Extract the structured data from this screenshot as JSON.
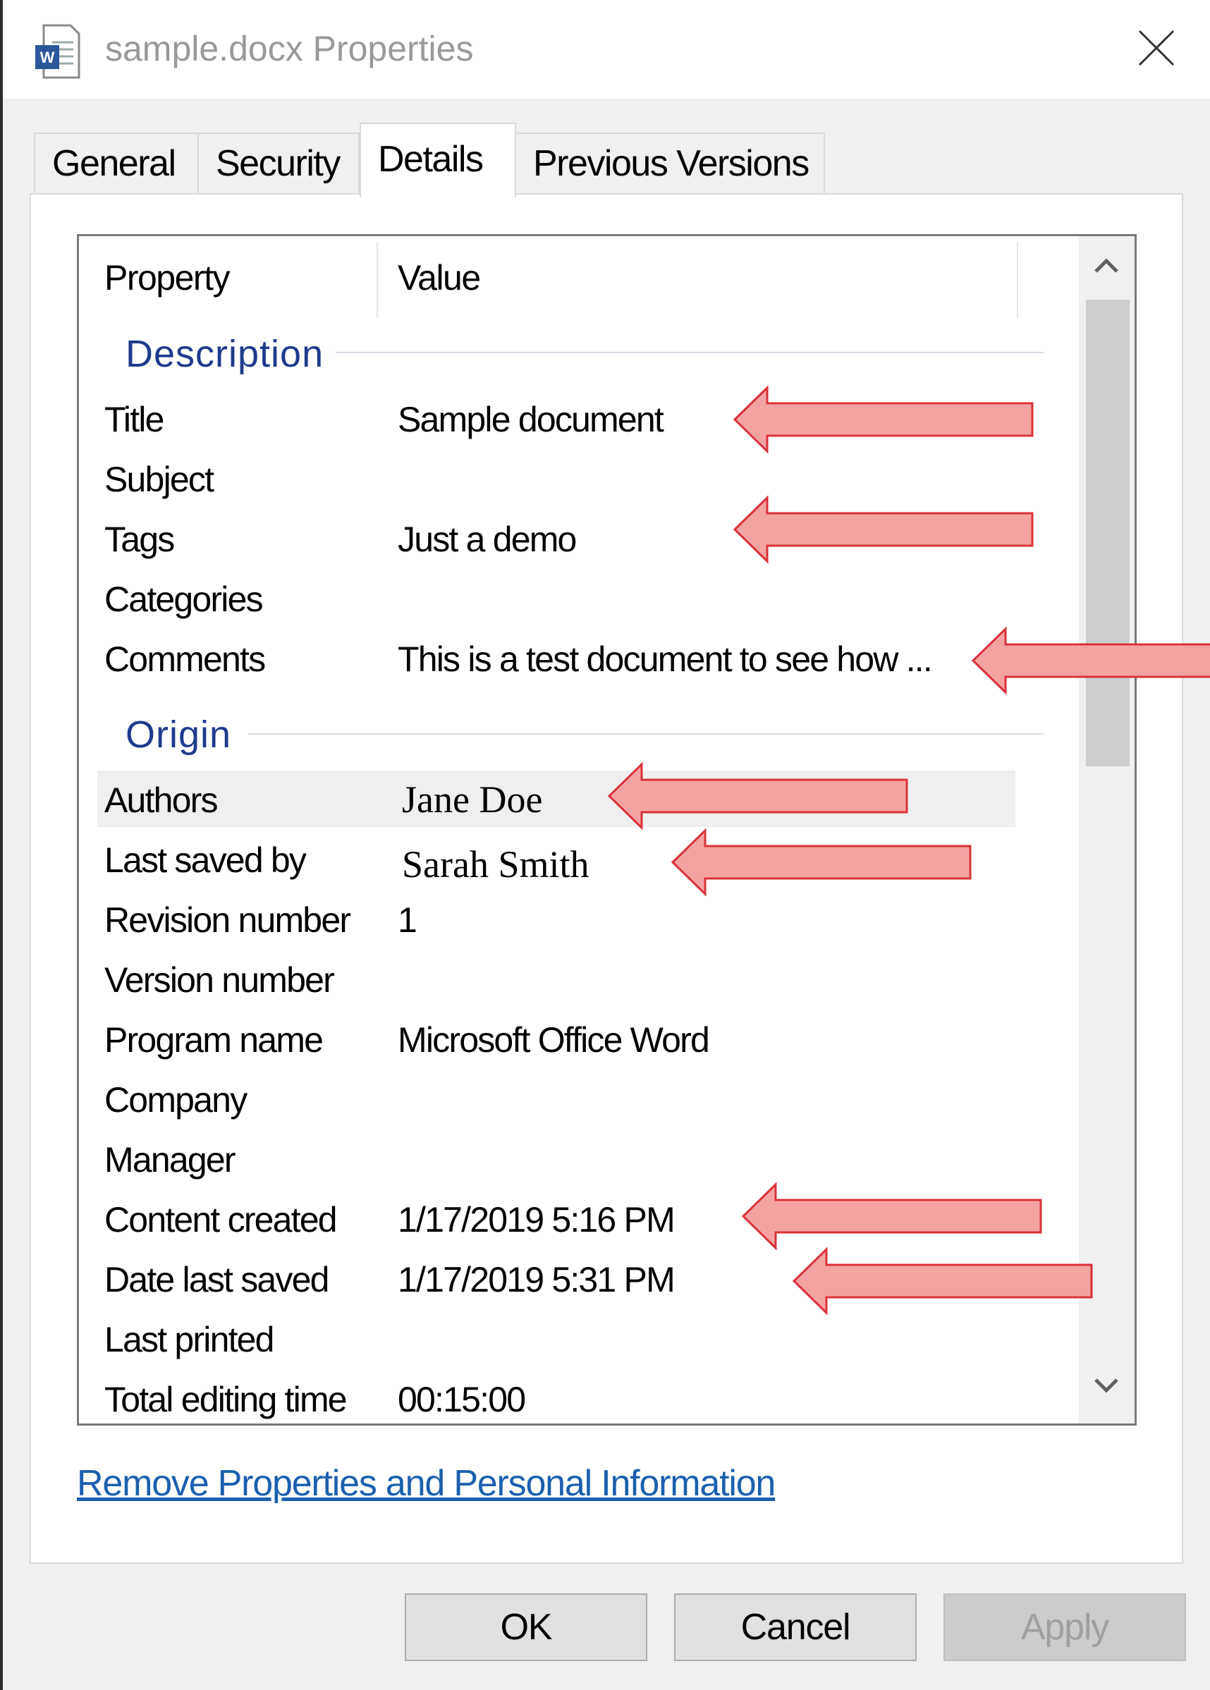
{
  "window": {
    "title": "sample.docx Properties",
    "app_icon": "word-document-icon",
    "close_icon": "close-icon"
  },
  "tabs": [
    {
      "label": "General",
      "active": false
    },
    {
      "label": "Security",
      "active": false
    },
    {
      "label": "Details",
      "active": true
    },
    {
      "label": "Previous Versions",
      "active": false
    }
  ],
  "list": {
    "columns": [
      "Property",
      "Value"
    ],
    "groups": [
      {
        "name": "Description",
        "rows": [
          {
            "property": "Title",
            "value": "Sample document"
          },
          {
            "property": "Subject",
            "value": ""
          },
          {
            "property": "Tags",
            "value": "Just a demo"
          },
          {
            "property": "Categories",
            "value": ""
          },
          {
            "property": "Comments",
            "value": "This is a test document to see how ..."
          }
        ]
      },
      {
        "name": "Origin",
        "rows": [
          {
            "property": "Authors",
            "value": "Jane Doe",
            "selected": true
          },
          {
            "property": "Last saved by",
            "value": "Sarah Smith"
          },
          {
            "property": "Revision number",
            "value": "1"
          },
          {
            "property": "Version number",
            "value": ""
          },
          {
            "property": "Program name",
            "value": "Microsoft Office Word"
          },
          {
            "property": "Company",
            "value": ""
          },
          {
            "property": "Manager",
            "value": ""
          },
          {
            "property": "Content created",
            "value": "1/17/2019 5:16 PM"
          },
          {
            "property": "Date last saved",
            "value": "1/17/2019 5:31 PM"
          },
          {
            "property": "Last printed",
            "value": ""
          },
          {
            "property": "Total editing time",
            "value": "00:15:00"
          }
        ]
      }
    ]
  },
  "scrollbar": {
    "up_icon": "chevron-up-icon",
    "down_icon": "chevron-down-icon"
  },
  "link": {
    "remove_label": "Remove Properties and Personal Information"
  },
  "buttons": {
    "ok": "OK",
    "cancel": "Cancel",
    "apply": "Apply",
    "apply_enabled": false
  },
  "annotations": {
    "arrow_color": "#f4a3a3",
    "arrow_outline": "#d9333a",
    "arrow_icon": "left-arrow-icon"
  }
}
